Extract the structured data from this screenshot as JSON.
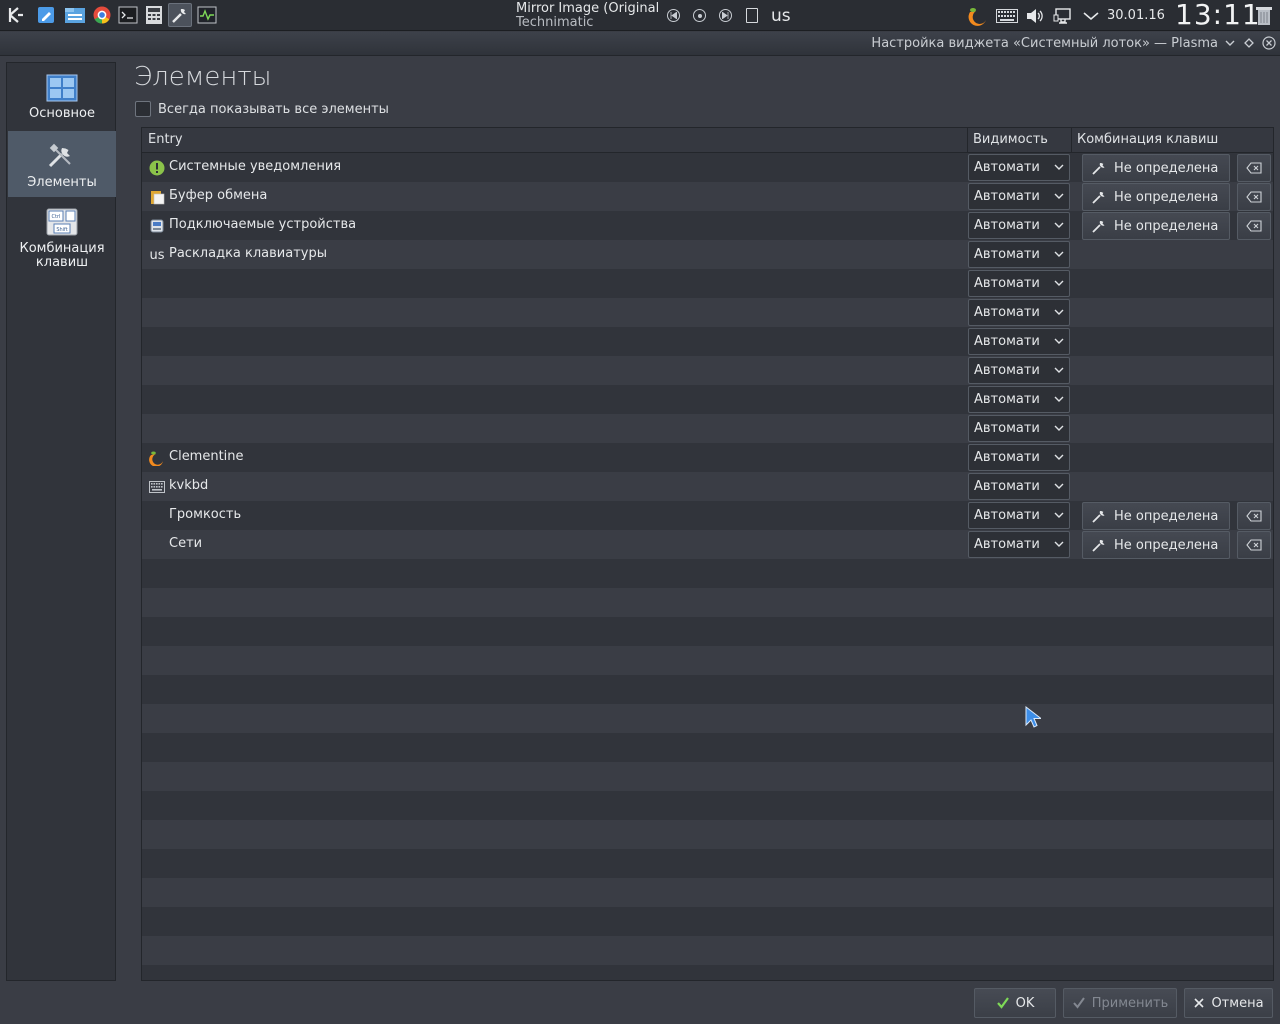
{
  "panel": {
    "now_playing": {
      "title": "Mirror Image (Original",
      "artist": "Technimatic"
    },
    "keyboard_layout": "us",
    "date": "30.01.16",
    "time": "13:11",
    "launchers": [
      {
        "icon": "kde-logo-icon"
      },
      {
        "icon": "kate-editor-icon"
      },
      {
        "icon": "file-manager-icon"
      },
      {
        "icon": "chromium-icon"
      },
      {
        "icon": "terminal-icon"
      },
      {
        "icon": "calculator-icon"
      },
      {
        "icon": "system-settings-icon"
      },
      {
        "icon": "system-monitor-icon"
      }
    ]
  },
  "window": {
    "title": "Настройка виджета «Системный лоток» — Plasma"
  },
  "sidebar": {
    "items": [
      {
        "label": "Основное",
        "icon": "general-icon",
        "selected": false
      },
      {
        "label": "Элементы",
        "icon": "tools-icon",
        "selected": true
      },
      {
        "label": "Комбинация клавиш",
        "icon": "keyboard-shortcut-icon",
        "selected": false
      }
    ]
  },
  "page": {
    "heading": "Элементы",
    "always_show_label": "Всегда показывать все элементы",
    "always_show_checked": false
  },
  "table": {
    "headers": {
      "entry": "Entry",
      "visibility": "Видимость",
      "shortcut": "Комбинация клавиш"
    },
    "shortcut_none": "Не определена",
    "rows": [
      {
        "label": "Системные уведомления",
        "icon": "notification-icon",
        "visibility": "Автомати",
        "has_shortcut": true
      },
      {
        "label": "Буфер обмена",
        "icon": "clipboard-icon",
        "visibility": "Автомати",
        "has_shortcut": true
      },
      {
        "label": "Подключаемые устройства",
        "icon": "device-notifier-icon",
        "visibility": "Автомати",
        "has_shortcut": true
      },
      {
        "label": "Раскладка клавиатуры",
        "icon": "keyboard-layout-icon",
        "icon_text": "us",
        "visibility": "Автомати",
        "has_shortcut": false
      },
      {
        "label": "",
        "icon": "",
        "visibility": "Автомати",
        "has_shortcut": false
      },
      {
        "label": "",
        "icon": "",
        "visibility": "Автомати",
        "has_shortcut": false
      },
      {
        "label": "",
        "icon": "",
        "visibility": "Автомати",
        "has_shortcut": false
      },
      {
        "label": "",
        "icon": "",
        "visibility": "Автомати",
        "has_shortcut": false
      },
      {
        "label": "",
        "icon": "",
        "visibility": "Автомати",
        "has_shortcut": false
      },
      {
        "label": "",
        "icon": "",
        "visibility": "Автомати",
        "has_shortcut": false
      },
      {
        "label": "Clementine",
        "icon": "clementine-icon",
        "visibility": "Автомати",
        "has_shortcut": false
      },
      {
        "label": "kvkbd",
        "icon": "virtual-keyboard-icon",
        "visibility": "Автомати",
        "has_shortcut": false
      },
      {
        "label": "Громкость",
        "icon": "",
        "visibility": "Автомати",
        "has_shortcut": true
      },
      {
        "label": "Сети",
        "icon": "",
        "visibility": "Автомати",
        "has_shortcut": true
      }
    ],
    "total_striped_rows": 29
  },
  "buttons": {
    "ok": "OK",
    "apply": "Применить",
    "cancel": "Отмена"
  }
}
